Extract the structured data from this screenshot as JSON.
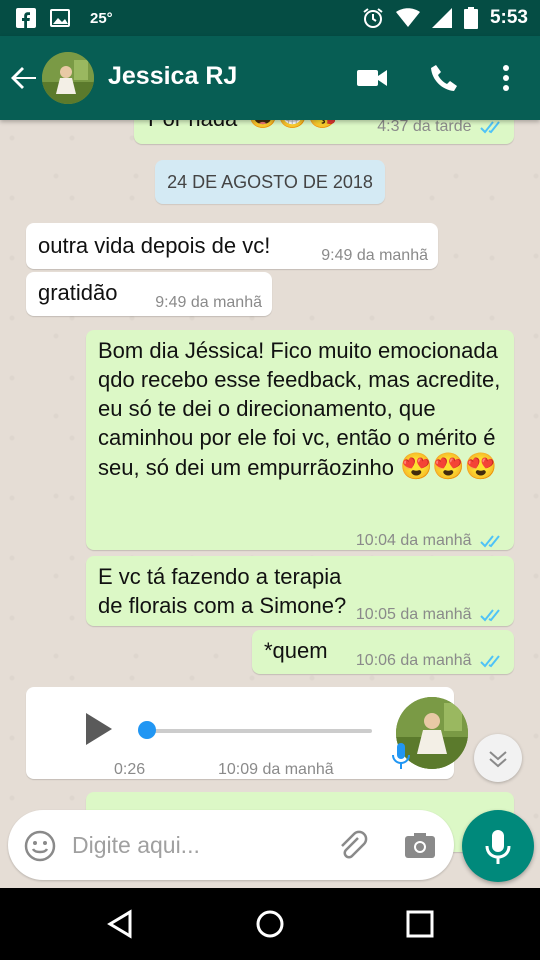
{
  "status_bar": {
    "temperature": "25°",
    "time": "5:53",
    "icons": [
      "facebook-icon",
      "image-icon",
      "alarm-icon",
      "wifi-icon",
      "signal-icon",
      "battery-icon"
    ]
  },
  "header": {
    "contact_name": "Jessica RJ",
    "icons": [
      "back-arrow-icon",
      "video-call-icon",
      "phone-icon",
      "more-vert-icon"
    ]
  },
  "chat": {
    "top_partial": {
      "text": "Por nada",
      "time": "4:37 da tarde"
    },
    "date_chip": "24 DE AGOSTO DE 2018",
    "messages": [
      {
        "text": "outra vida depois de vc!",
        "time": "9:49 da manhã"
      },
      {
        "text": "gratidão",
        "time": "9:49 da manhã"
      },
      {
        "text": "Bom dia Jéssica! Fico muito emocionada qdo recebo esse feedback, mas acredite, eu só te dei o direcionamento, que caminhou por ele foi vc, então o mérito é seu, só dei um empurrãozinho",
        "emoji": "😍😍😍",
        "time": "10:04 da manhã"
      },
      {
        "text": "E vc tá fazendo a terapia de florais com a Simone?",
        "time": "10:05 da manhã"
      },
      {
        "text": "*quem",
        "time": "10:06 da manhã"
      }
    ],
    "audio": {
      "duration": "0:26",
      "time": "10:09 da manhã",
      "progress": 0
    }
  },
  "composer": {
    "placeholder": "Digite aqui..."
  },
  "colors": {
    "header": "#075e54",
    "status_bar": "#054d44",
    "outgoing_bubble": "#dcf8c6",
    "incoming_bubble": "#ffffff",
    "read_ticks": "#4fc3f7",
    "fab": "#00897b"
  }
}
